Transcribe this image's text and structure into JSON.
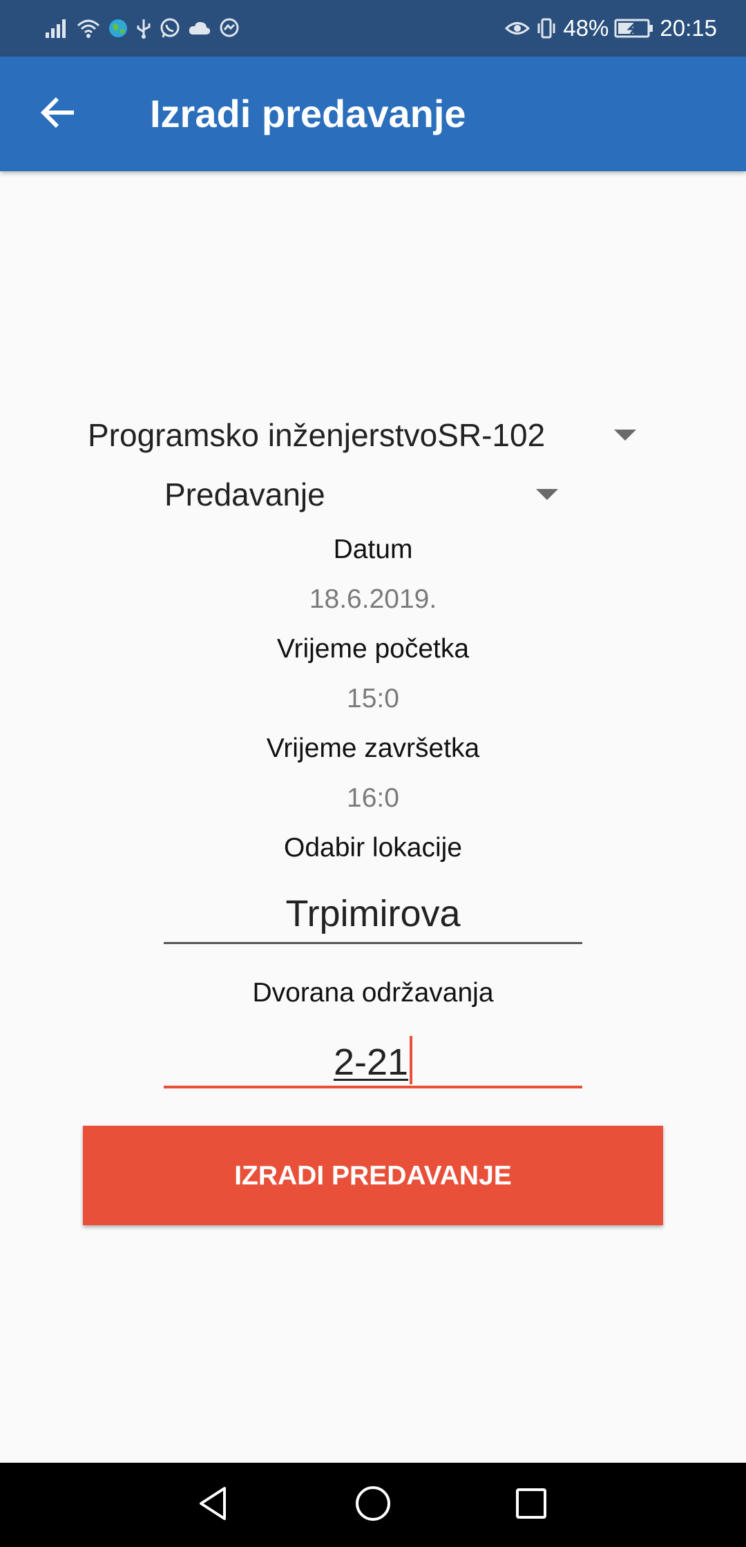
{
  "status_bar": {
    "battery": "48%",
    "time": "20:15",
    "icons": [
      "signal-icon",
      "wifi-icon",
      "globe-icon",
      "usb-icon",
      "whatsapp-icon",
      "cloud-icon",
      "messenger-icon",
      "eye-icon",
      "vibrate-icon",
      "battery-icon"
    ]
  },
  "app_bar": {
    "title": "Izradi predavanje",
    "back_icon": "arrow-back-icon"
  },
  "form": {
    "course_spinner": "Programsko inženjerstvoSR-102",
    "type_spinner": "Predavanje",
    "date_label": "Datum",
    "date_value": "18.6.2019.",
    "start_label": "Vrijeme početka",
    "start_value": "15:0",
    "end_label": "Vrijeme završetka",
    "end_value": "16:0",
    "location_label": "Odabir lokacije",
    "location_value": "Trpimirova",
    "hall_label": "Dvorana održavanja",
    "hall_value": "2-21"
  },
  "actions": {
    "create_label": "IZRADI PREDAVANJE"
  },
  "colors": {
    "status_bar": "#2a4f7c",
    "app_bar": "#2a6ebc",
    "accent": "#e8503a",
    "background": "#fafafa"
  },
  "nav_bar": {
    "icons": [
      "back-triangle-icon",
      "home-circle-icon",
      "recents-square-icon"
    ]
  }
}
